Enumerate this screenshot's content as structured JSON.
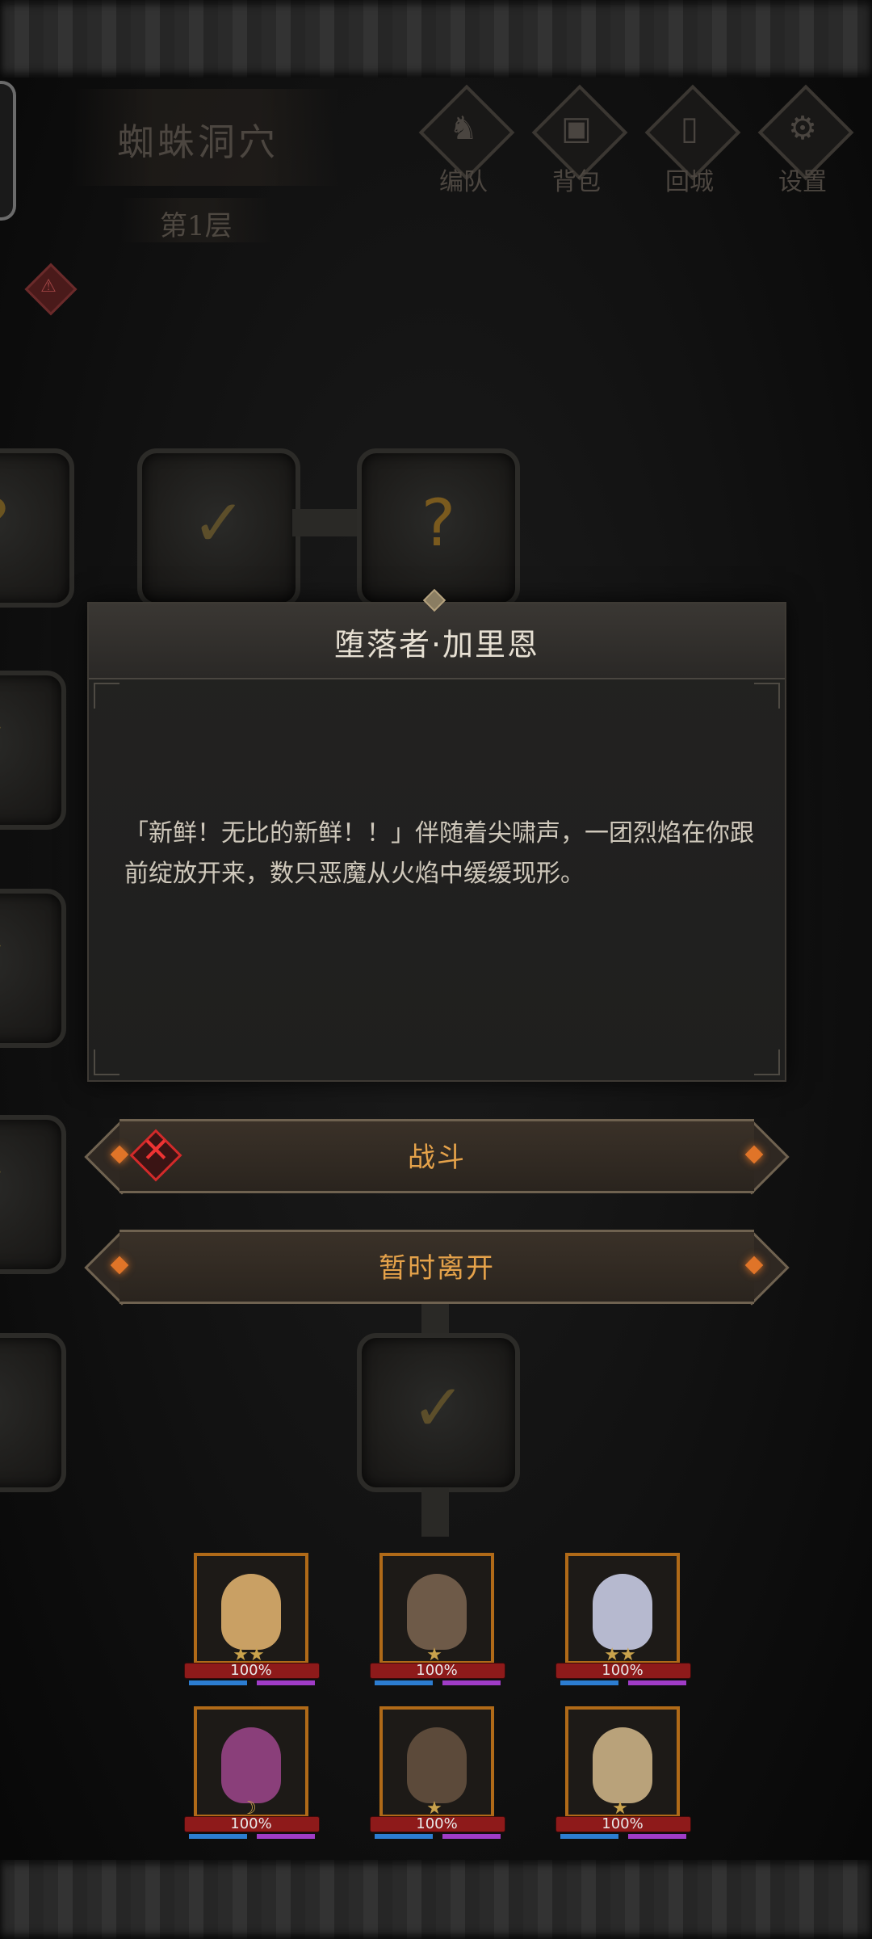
{
  "header": {
    "dungeon_name": "蜘蛛洞穴",
    "floor": "第1层",
    "menu": [
      {
        "label": "编队",
        "icon": "helmet-icon"
      },
      {
        "label": "背包",
        "icon": "backpack-icon"
      },
      {
        "label": "回城",
        "icon": "door-icon"
      },
      {
        "label": "设置",
        "icon": "gear-icon"
      }
    ]
  },
  "map": {
    "tiles": [
      {
        "state": "visited",
        "mark": "✓"
      },
      {
        "state": "unknown",
        "mark": "?"
      },
      {
        "state": "visited",
        "mark": "✓"
      }
    ]
  },
  "dialog": {
    "title": "堕落者·加里恩",
    "body": "「新鲜！无比的新鲜！！」伴随着尖啸声，一团烈焰在你跟前绽放开来，数只恶魔从火焰中缓缓现形。"
  },
  "actions": {
    "fight_label": "战斗",
    "leave_label": "暂时离开"
  },
  "heroes": [
    {
      "hp": "100%",
      "stars": "★★",
      "color": "#c9a064"
    },
    {
      "hp": "100%",
      "stars": "★",
      "color": "#6e5a48"
    },
    {
      "hp": "100%",
      "stars": "★★",
      "color": "#b6b9cf"
    },
    {
      "hp": "100%",
      "stars": "☽",
      "color": "#8a3f7a"
    },
    {
      "hp": "100%",
      "stars": "★",
      "color": "#5c4a3a"
    },
    {
      "hp": "100%",
      "stars": "★",
      "color": "#b9a27a"
    }
  ]
}
